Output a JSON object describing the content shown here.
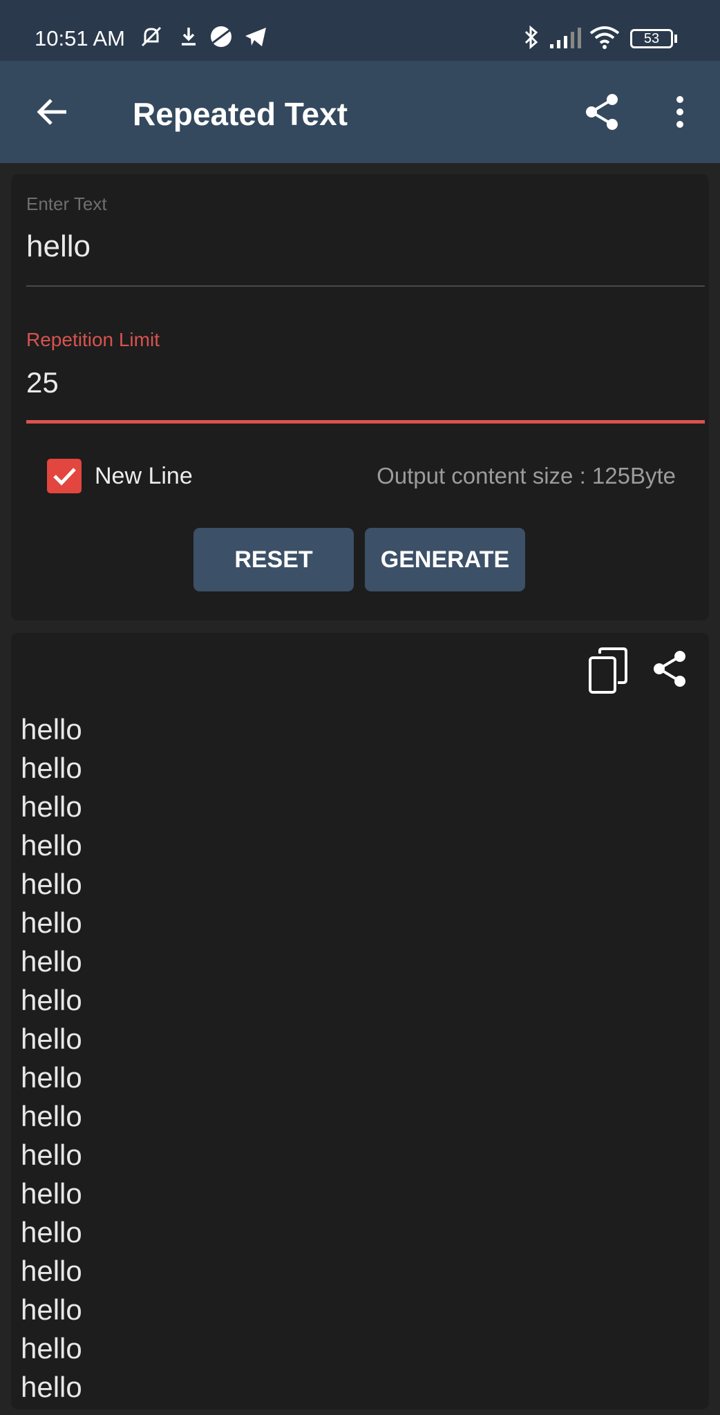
{
  "status_bar": {
    "time": "10:51 AM",
    "battery": "53",
    "icons": [
      "mute-icon",
      "download-icon",
      "vpn-icon",
      "telegram-icon",
      "bluetooth-icon",
      "signal-icon",
      "wifi-icon",
      "battery-icon"
    ]
  },
  "app_bar": {
    "title": "Repeated Text",
    "back_icon": "arrow-back-icon",
    "share_icon": "share-icon",
    "menu_icon": "more-vert-icon"
  },
  "form": {
    "text_label": "Enter Text",
    "text_value": "hello",
    "limit_label": "Repetition Limit",
    "limit_value": "25",
    "newline_label": "New Line",
    "newline_checked": true,
    "output_size": "Output content size : 125Byte",
    "reset_label": "RESET",
    "generate_label": "GENERATE"
  },
  "output": {
    "copy_icon": "copy-icon",
    "share_icon": "share-icon",
    "lines": [
      "hello",
      "hello",
      "hello",
      "hello",
      "hello",
      "hello",
      "hello",
      "hello",
      "hello",
      "hello",
      "hello",
      "hello",
      "hello",
      "hello",
      "hello",
      "hello",
      "hello",
      "hello"
    ]
  },
  "colors": {
    "status_bar": "#2a3a4c",
    "app_bar": "#34495e",
    "accent": "#d9534f",
    "button": "#3c5067",
    "card": "#1d1d1d"
  }
}
